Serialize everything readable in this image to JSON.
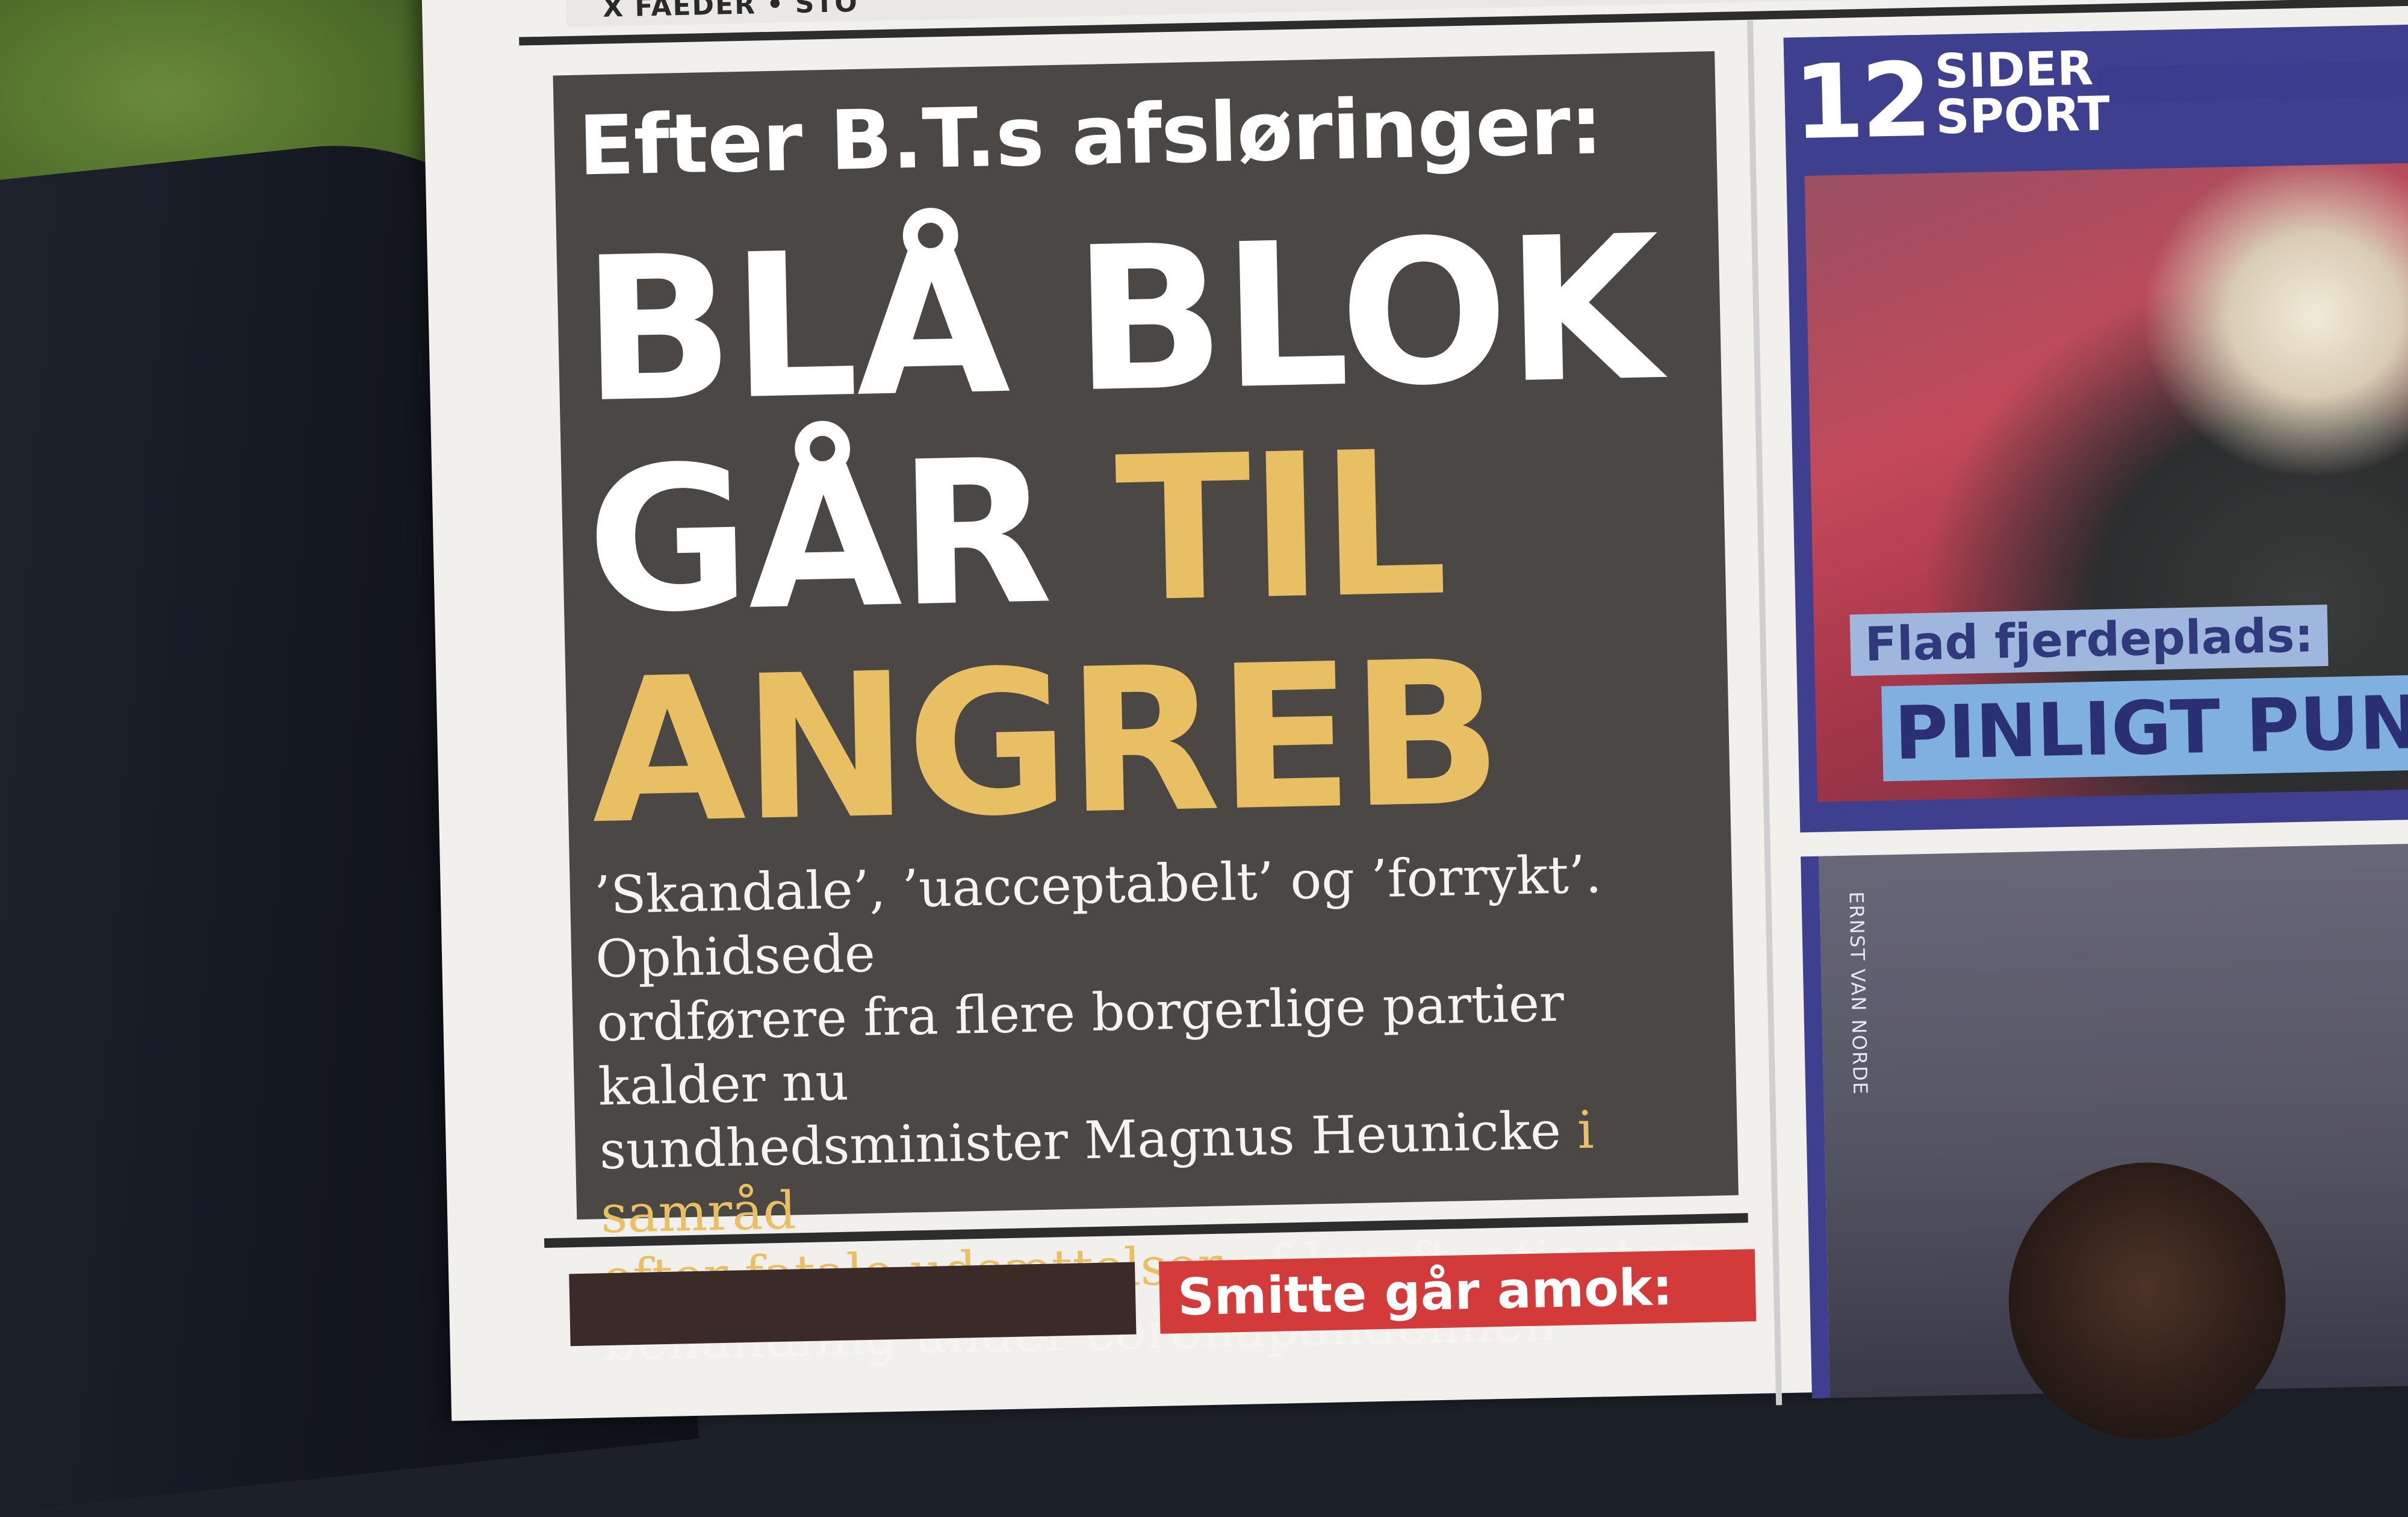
{
  "masthead_fragment": "X FAEDER • STO",
  "lead_story": {
    "kicker": "Efter B.T.s afsløringer:",
    "headline_line1": "BLÅ BLOK",
    "headline_line2_white": "GÅR",
    "headline_line2_yellow": "TIL",
    "headline_line3_yellow": "ANGREB",
    "deck_line1": "’Skandale’, ’uacceptabelt’ og ’forrykt’. Ophidsede",
    "deck_line2": "ordførere fra flere borgerlige partier kalder nu",
    "deck_line3_plain": "sundhedsminister Magnus Heunicke ",
    "deck_line3_highlight": "i samråd",
    "deck_line4_highlight": "efter fatale udsættelser",
    "deck_line4_plain": " af kræftpatienters",
    "deck_line5": "behandling under coronapandemien"
  },
  "sports_teaser": {
    "badge_number": "12",
    "badge_line1": "SIDER",
    "badge_line2": "SPORT",
    "kicker": "Flad fjerdeplads:",
    "headline": "PINLIGT PUN"
  },
  "photo_credit": "ERNST VAN NORDE",
  "bottom_teaser": "Smitte går amok:",
  "colors": {
    "headline_yellow": "#e9bf63",
    "lead_background": "#4a4745",
    "sports_blue": "#3f3f8f",
    "teaser_red": "#d33a3a"
  }
}
